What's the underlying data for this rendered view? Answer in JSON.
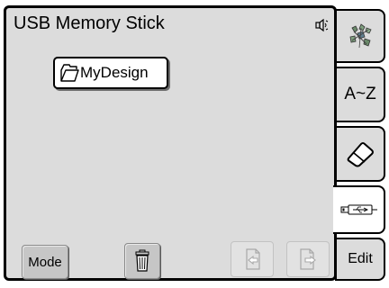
{
  "header": {
    "title": "USB Memory Stick",
    "speaker_icon": "speaker-icon"
  },
  "content": {
    "folders": [
      {
        "label": "MyDesign",
        "icon": "folder-icon"
      }
    ]
  },
  "toolbar": {
    "mode_label": "Mode",
    "delete_icon": "trash-icon",
    "import_icon": "import-icon",
    "export_icon": "export-icon"
  },
  "side_tabs": {
    "embroidery_icon": "embroidery-pattern-icon",
    "characters_label": "A~Z",
    "eraser_icon": "eraser-icon",
    "usb_icon": "usb-icon",
    "edit_label": "Edit"
  },
  "colors": {
    "panel_bg": "#dcdcdc",
    "frame": "#000000",
    "button_bg": "#c6c6c6",
    "disabled_button_bg": "#e2e2e2"
  }
}
